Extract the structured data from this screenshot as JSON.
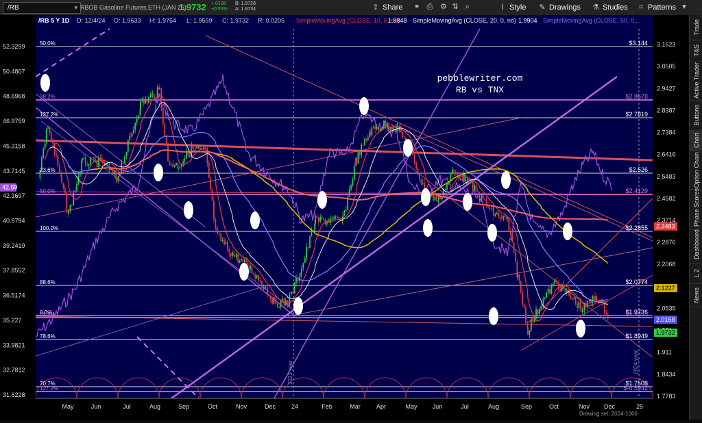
{
  "toolbar": {
    "symbol": "/RB",
    "description": "RBOB Gasoline Futures,ETH (JAN 25)",
    "last": "1.9732",
    "change": "+.0108",
    "change_pct": "+0.55%",
    "bid": "B: 1.9728",
    "ask": "A: 1.9734",
    "buttons": [
      {
        "label": "Share",
        "icon": "share-icon"
      },
      {
        "label": "Style",
        "icon": "style-icon"
      },
      {
        "label": "Drawings",
        "icon": "pencil-icon"
      },
      {
        "label": "Studies",
        "icon": "flask-icon"
      },
      {
        "label": "Patterns",
        "icon": "patterns-icon"
      }
    ]
  },
  "right_tabs": [
    "Trade",
    "T&S",
    "Active Trader",
    "Buttons",
    "Chart",
    "Option Chain",
    "Phase Scores",
    "Dashboard",
    "L 2",
    "News"
  ],
  "chart_data": {
    "type": "candlestick",
    "header": {
      "symbol_period": "/RB 5 Y 1D",
      "date": "D: 12/4/24",
      "open": "O: 1.9633",
      "high": "H: 1.9764",
      "low": "L: 1.9559",
      "close": "C: 1.9732",
      "range": "R: 0.0205",
      "studies": [
        {
          "label": "SimpleMovingAvg (CLOSE, 10, 0, no)",
          "value": "1.9848",
          "color": "#e03c3c"
        },
        {
          "label": "SimpleMovingAvg (CLOSE, 20, 0, no)",
          "value": "1.9904",
          "color": "#e6e6e6"
        },
        {
          "label": "SimpleMovingAvg (CLOSE, 50, 0,...",
          "value": "",
          "color": "#7a6cf0"
        }
      ]
    },
    "watermark": [
      "pebblewriter.com",
      "RB vs TNX"
    ],
    "x_labels": [
      "May",
      "Jun",
      "Jul",
      "Aug",
      "Sep",
      "Oct",
      "Nov",
      "Dec",
      "24",
      "Feb",
      "Mar",
      "Apr",
      "May",
      "Jun",
      "Jul",
      "Aug",
      "Sep",
      "Oct",
      "Nov",
      "Dec",
      "25"
    ],
    "left_axis_ticks": [
      "52.3299",
      "50.4807",
      "48.6968",
      "46.9759",
      "45.3158",
      "43.7145",
      "42.1697",
      "40.6794",
      "39.2419",
      "37.8552",
      "36.5174",
      "35.227",
      "33.9821",
      "32.7812",
      "31.6228"
    ],
    "right_axis_ticks": [
      "3.1623",
      "3.0505",
      "2.9427",
      "2.8387",
      "2.7384",
      "2.6416",
      "2.5483",
      "2.4582",
      "2.3714",
      "2.2876",
      "2.2068",
      "2.1289",
      "2.0535",
      "1.981",
      "1.911",
      "1.8434",
      "1.7783"
    ],
    "tnx_marker": {
      "value": "42.69",
      "color": "#a050e0"
    },
    "price_markers": [
      {
        "value": "2.3483",
        "color": "#e03c3c"
      },
      {
        "value": "2.1227",
        "color": "#d4b400"
      },
      {
        "value": "2.0158",
        "color": "#5050e0"
      },
      {
        "value": "1.9732",
        "color": "#2ecc40"
      }
    ],
    "fib_levels": [
      {
        "left": "50.0%",
        "right": "$3.144",
        "right_color": "#ffffff"
      },
      {
        "left": "38.2%",
        "right": "$2.8678",
        "right_color": "#d070e0"
      },
      {
        "left": "127.2%",
        "right": "$2.7819",
        "right_color": "#ffffff"
      },
      {
        "left": "23.6%",
        "right": "$2.526",
        "right_color": "#ffffff"
      },
      {
        "left": "50.0%",
        "right": "$2.4129",
        "right_color": "#d070e0"
      },
      {
        "left": "100.0%",
        "right": "$2.2855",
        "right_color": "#ffffff"
      },
      {
        "left": "88.6%",
        "right": "$2.0774",
        "right_color": "#ffffff"
      },
      {
        "left": "0.0%",
        "right": "$1.9736",
        "right_color": "#ffffff"
      },
      {
        "left": "61.8%",
        "right": "$1.9333",
        "right_color": "#d070e0"
      },
      {
        "left": "78.6%",
        "right": "$1.8949",
        "right_color": "#ffffff"
      },
      {
        "left": "70.7%",
        "right": "$1.7508",
        "right_color": "#ffffff"
      },
      {
        "left": "127.2%",
        "right": "$-0.5942",
        "right_color": "#d070e0"
      }
    ],
    "vertical_labels": [
      "2023 year",
      "2024 year"
    ],
    "footer": "Drawing set: 2024-1006",
    "series": [
      {
        "name": "SimpleMovingAvg (CLOSE, 10, 0, no)",
        "color": "#e03c3c"
      },
      {
        "name": "SimpleMovingAvg (CLOSE, 20, 0, no)",
        "color": "#e6e6e6"
      },
      {
        "name": "SimpleMovingAvg (CLOSE, 50, 0, no)",
        "color": "#7a6cf0"
      }
    ],
    "grid": false
  }
}
